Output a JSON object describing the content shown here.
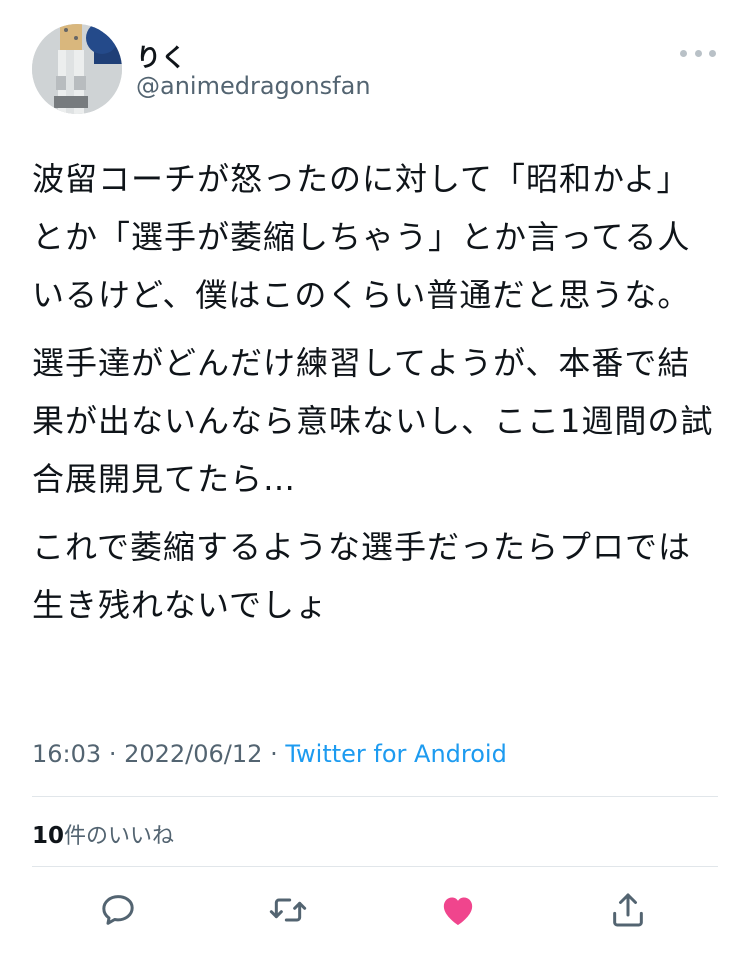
{
  "profile": {
    "display_name": "りく",
    "handle": "@animedragonsfan"
  },
  "tweet": {
    "paragraphs": [
      "波留コーチが怒ったのに対して「昭和かよ」とか「選手が萎縮しちゃう」とか言ってる人いるけど、僕はこのくらい普通だと思うな。",
      "選手達がどんだけ練習してようが、本番で結果が出ないんなら意味ないし、ここ1週間の試合展開見てたら…",
      "これで萎縮するような選手だったらプロでは生き残れないでしょ"
    ],
    "time": "16:03",
    "date": "2022/06/12",
    "separator": "·",
    "source": "Twitter for Android"
  },
  "stats": {
    "likes_count": "10",
    "likes_label": "件のいいね"
  },
  "actions": {
    "reply_icon": "reply-icon",
    "retweet_icon": "retweet-icon",
    "like_icon": "heart-icon",
    "share_icon": "share-icon",
    "like_color": "#f0458d",
    "icon_color": "#536471"
  }
}
